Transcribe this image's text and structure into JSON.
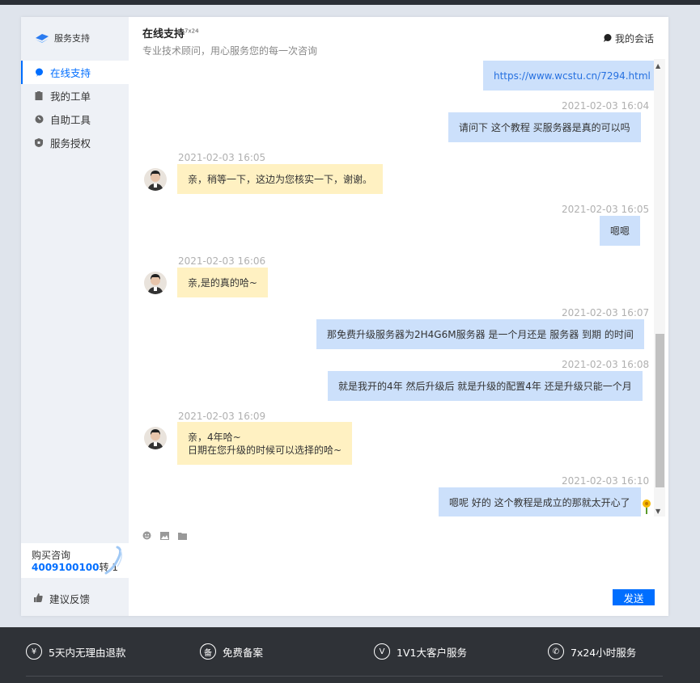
{
  "sidebar": {
    "logo_text": "服务支持",
    "items": [
      {
        "label": "在线支持",
        "icon": "chat-icon",
        "active": true
      },
      {
        "label": "我的工单",
        "icon": "clipboard-icon",
        "active": false
      },
      {
        "label": "自助工具",
        "icon": "wrench-icon",
        "active": false
      },
      {
        "label": "服务授权",
        "icon": "shield-icon",
        "active": false
      }
    ],
    "buy_title": "购买咨询",
    "buy_phone": "4009100100",
    "buy_ext": "转 1",
    "feedback_label": "建议反馈"
  },
  "chat": {
    "title": "在线支持",
    "title_badge": "7x24",
    "subtitle": "专业技术顾问，用心服务您的每一次咨询",
    "my_session_label": "我的会话",
    "messages": [
      {
        "from": "me",
        "time": "",
        "text": "https://www.wcstu.cn/7294.html"
      },
      {
        "from": "me",
        "time": "2021-02-03 16:04",
        "text": "请问下 这个教程 买服务器是真的可以吗"
      },
      {
        "from": "agent",
        "time": "2021-02-03 16:05",
        "text": "亲，稍等一下，这边为您核实一下，谢谢。"
      },
      {
        "from": "me",
        "time": "2021-02-03 16:05",
        "text": "嗯嗯"
      },
      {
        "from": "agent",
        "time": "2021-02-03 16:06",
        "text": "亲,是的真的哈~"
      },
      {
        "from": "me",
        "time": "2021-02-03 16:07",
        "text": "那免费升级服务器为2H4G6M服务器 是一个月还是 服务器 到期 的时间"
      },
      {
        "from": "me",
        "time": "2021-02-03 16:08",
        "text": "就是我开的4年 然后升级后 就是升级的配置4年 还是升级只能一个月"
      },
      {
        "from": "agent",
        "time": "2021-02-03 16:09",
        "text": "亲，4年哈~",
        "text2": "日期在您升级的时候可以选择的哈~"
      },
      {
        "from": "me",
        "time": "2021-02-03 16:10",
        "text": "嗯呢 好的 这个教程是成立的那就太开心了"
      }
    ],
    "send_label": "发送"
  },
  "footer": {
    "items": [
      {
        "label": "5天内无理由退款",
        "icon": "yen-icon",
        "glyph": "¥"
      },
      {
        "label": "免费备案",
        "icon": "record-icon",
        "glyph": "备"
      },
      {
        "label": "1V1大客户服务",
        "icon": "vip-service-icon",
        "glyph": "V"
      },
      {
        "label": "7x24小时服务",
        "icon": "phone-icon",
        "glyph": "✆"
      }
    ]
  },
  "colors": {
    "accent": "#006eff",
    "my_bubble": "#cce0fb",
    "agent_bubble": "#fff1c2",
    "footer_bg": "#2f3237"
  }
}
